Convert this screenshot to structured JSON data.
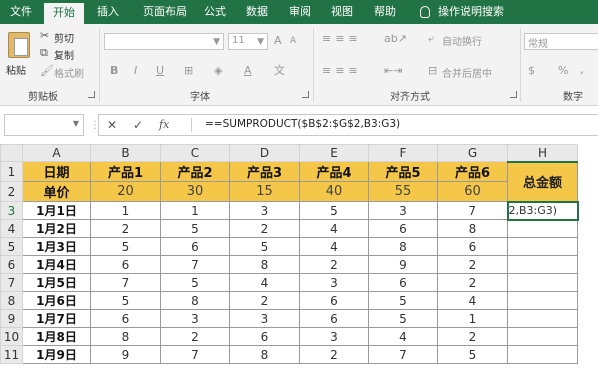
{
  "ribbon_tabs": [
    "文件",
    "开始",
    "插入",
    "页面布局",
    "公式",
    "数据",
    "审阅",
    "视图",
    "帮助",
    "操作说明搜索"
  ],
  "active_tab": "开始",
  "clipboard": {
    "paste": "粘贴",
    "cut": "剪切",
    "copy": "复制",
    "format_painter": "格式刷",
    "label": "剪贴板"
  },
  "font": {
    "size": "11",
    "label": "字体",
    "bold": "B",
    "italic": "I",
    "underline": "U",
    "grow": "A",
    "shrink": "A"
  },
  "alignment": {
    "wrap": "自动换行",
    "merge": "合并后居中",
    "label": "对齐方式"
  },
  "number": {
    "format": "常规",
    "label": "数字",
    "percent": "%",
    "comma": ","
  },
  "formula_bar": {
    "fx": "fx",
    "formula": "==SUMPRODUCT($B$2:$G$2,B3:G3)"
  },
  "columns": [
    "A",
    "B",
    "C",
    "D",
    "E",
    "F",
    "G",
    "H"
  ],
  "rows": [
    "1",
    "2",
    "3",
    "4",
    "5",
    "6",
    "7",
    "8",
    "9",
    "10",
    "11"
  ],
  "header_row": [
    "日期",
    "产品1",
    "产品2",
    "产品3",
    "产品4",
    "产品5",
    "产品6"
  ],
  "price_row": {
    "label": "单价",
    "values": [
      "20",
      "30",
      "15",
      "40",
      "55",
      "60"
    ]
  },
  "total_header": "总金额",
  "data_rows": [
    {
      "date": "1月1日",
      "values": [
        "1",
        "1",
        "3",
        "5",
        "3",
        "7"
      ]
    },
    {
      "date": "1月2日",
      "values": [
        "2",
        "5",
        "2",
        "4",
        "6",
        "8"
      ]
    },
    {
      "date": "1月3日",
      "values": [
        "5",
        "6",
        "5",
        "4",
        "8",
        "6"
      ]
    },
    {
      "date": "1月4日",
      "values": [
        "6",
        "7",
        "8",
        "2",
        "9",
        "2"
      ]
    },
    {
      "date": "1月5日",
      "values": [
        "7",
        "5",
        "4",
        "3",
        "6",
        "2"
      ]
    },
    {
      "date": "1月6日",
      "values": [
        "5",
        "8",
        "2",
        "6",
        "5",
        "4"
      ]
    },
    {
      "date": "1月7日",
      "values": [
        "6",
        "3",
        "3",
        "6",
        "5",
        "1"
      ]
    },
    {
      "date": "1月8日",
      "values": [
        "8",
        "2",
        "6",
        "3",
        "4",
        "2"
      ]
    },
    {
      "date": "1月9日",
      "values": [
        "9",
        "7",
        "8",
        "2",
        "7",
        "5"
      ]
    }
  ],
  "editing_cell_text": "2,B3:G3)"
}
